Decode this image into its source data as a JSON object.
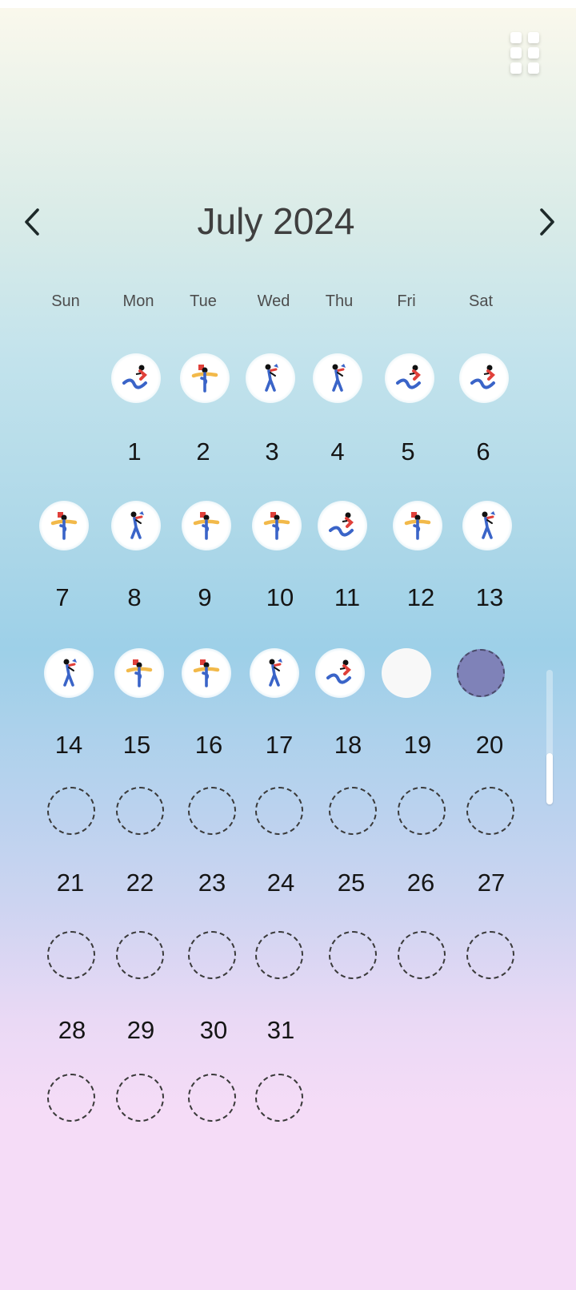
{
  "header": {
    "month_title": "July 2024"
  },
  "weekdays": [
    "Sun",
    "Mon",
    "Tue",
    "Wed",
    "Thu",
    "Fri",
    "Sat"
  ],
  "days": [
    {
      "num": "1",
      "status": "done",
      "icon": "sitting-person-icon"
    },
    {
      "num": "2",
      "status": "done",
      "icon": "scarf-person-icon"
    },
    {
      "num": "3",
      "status": "done",
      "icon": "walking-person-icon"
    },
    {
      "num": "4",
      "status": "done",
      "icon": "walking-person-icon"
    },
    {
      "num": "5",
      "status": "done",
      "icon": "sitting-person-icon"
    },
    {
      "num": "6",
      "status": "done",
      "icon": "sitting-person-icon"
    },
    {
      "num": "7",
      "status": "done",
      "icon": "scarf-person-icon"
    },
    {
      "num": "8",
      "status": "done",
      "icon": "walking-person-icon"
    },
    {
      "num": "9",
      "status": "done",
      "icon": "scarf-person-icon"
    },
    {
      "num": "10",
      "status": "done",
      "icon": "scarf-person-icon"
    },
    {
      "num": "11",
      "status": "done",
      "icon": "sitting-person-icon"
    },
    {
      "num": "12",
      "status": "done",
      "icon": "scarf-person-icon"
    },
    {
      "num": "13",
      "status": "done",
      "icon": "walking-person-icon"
    },
    {
      "num": "14",
      "status": "done",
      "icon": "walking-person-icon"
    },
    {
      "num": "15",
      "status": "done",
      "icon": "scarf-person-icon"
    },
    {
      "num": "16",
      "status": "done",
      "icon": "scarf-person-icon"
    },
    {
      "num": "17",
      "status": "done",
      "icon": "walking-person-icon"
    },
    {
      "num": "18",
      "status": "done",
      "icon": "sitting-person-icon"
    },
    {
      "num": "19",
      "status": "empty",
      "icon": ""
    },
    {
      "num": "20",
      "status": "selected",
      "icon": ""
    },
    {
      "num": "21",
      "status": "future",
      "icon": ""
    },
    {
      "num": "22",
      "status": "future",
      "icon": ""
    },
    {
      "num": "23",
      "status": "future",
      "icon": ""
    },
    {
      "num": "24",
      "status": "future",
      "icon": ""
    },
    {
      "num": "25",
      "status": "future",
      "icon": ""
    },
    {
      "num": "26",
      "status": "future",
      "icon": ""
    },
    {
      "num": "27",
      "status": "future",
      "icon": ""
    },
    {
      "num": "28",
      "status": "future",
      "icon": ""
    },
    {
      "num": "29",
      "status": "future",
      "icon": ""
    },
    {
      "num": "30",
      "status": "future",
      "icon": ""
    },
    {
      "num": "31",
      "status": "future",
      "icon": ""
    }
  ],
  "colors": {
    "selected_fill": "#7f82b8",
    "figure_blue": "#3a64c8",
    "figure_red": "#e0403a",
    "figure_yellow": "#f2b94a"
  }
}
